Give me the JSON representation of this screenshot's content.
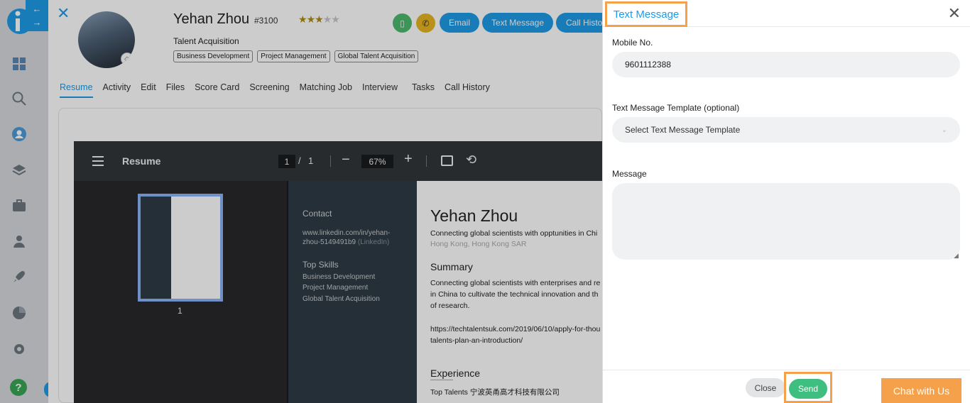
{
  "sidebar": {
    "items": [
      {
        "icon": "dashboard-icon"
      },
      {
        "icon": "search-icon"
      },
      {
        "icon": "candidates-icon"
      },
      {
        "icon": "layers-icon"
      },
      {
        "icon": "jobs-briefcase-icon"
      },
      {
        "icon": "contacts-icon"
      },
      {
        "icon": "rocket-icon"
      },
      {
        "icon": "reports-pie-icon"
      },
      {
        "icon": "settings-gear-icon"
      }
    ],
    "help": "?"
  },
  "candidate": {
    "name": "Yehan Zhou",
    "id": "#3100",
    "rating": 3,
    "rating_max": 5,
    "title": "Talent Acquisition",
    "tags": [
      "Business Development",
      "Project Management",
      "Global Talent Acquisition"
    ]
  },
  "actions": {
    "email": "Email",
    "text_message": "Text Message",
    "call_history": "Call History"
  },
  "tabs": [
    {
      "label": "Resume",
      "active": true
    },
    {
      "label": "Activity"
    },
    {
      "label": "Edit"
    },
    {
      "label": "Files"
    },
    {
      "label": "Score Card"
    },
    {
      "label": "Screening"
    },
    {
      "label": "Matching Job"
    },
    {
      "label": "Interview"
    },
    {
      "label": "Tasks"
    },
    {
      "label": "Call History"
    }
  ],
  "pdf_viewer": {
    "title": "Resume",
    "page": "1",
    "page_separator": "/",
    "total_pages": "1",
    "zoom": "67%",
    "thumbnail_label": "1"
  },
  "resume": {
    "contact_heading": "Contact",
    "linkedin": "www.linkedin.com/in/yehan-zhou-5149491b9",
    "linkedin_suffix": "(LinkedIn)",
    "skills_heading": "Top Skills",
    "skills": [
      "Business Development",
      "Project Management",
      "Global Talent Acquisition"
    ],
    "name": "Yehan Zhou",
    "headline": "Connecting global scientists with opptunities in Chi",
    "location": "Hong Kong, Hong Kong SAR",
    "summary_heading": "Summary",
    "summary_lines": [
      "Connecting global scientists with enterprises and re",
      "in China to cultivate the technical innovation and th",
      "of research."
    ],
    "link_lines": [
      "https://techtalentsuk.com/2019/06/10/apply-for-thou",
      "talents-plan-an-introduction/"
    ],
    "experience_heading": "Experience",
    "experience_line": "Top Talents 宁波英甬高才科技有限公司"
  },
  "text_message_panel": {
    "title": "Text Message",
    "mobile_label": "Mobile No.",
    "mobile_value": "9601112388",
    "template_label": "Text Message Template (optional)",
    "template_placeholder": "Select Text Message Template",
    "message_label": "Message",
    "message_value": "",
    "close_button": "Close",
    "send_button": "Send"
  },
  "chat_widget": {
    "label": "Chat with Us"
  },
  "colors": {
    "accent": "#1e9be6",
    "highlight": "#f5a04a",
    "send": "#3fbf7f",
    "call_button": "#e8b520",
    "file_button": "#4cbb6c"
  }
}
